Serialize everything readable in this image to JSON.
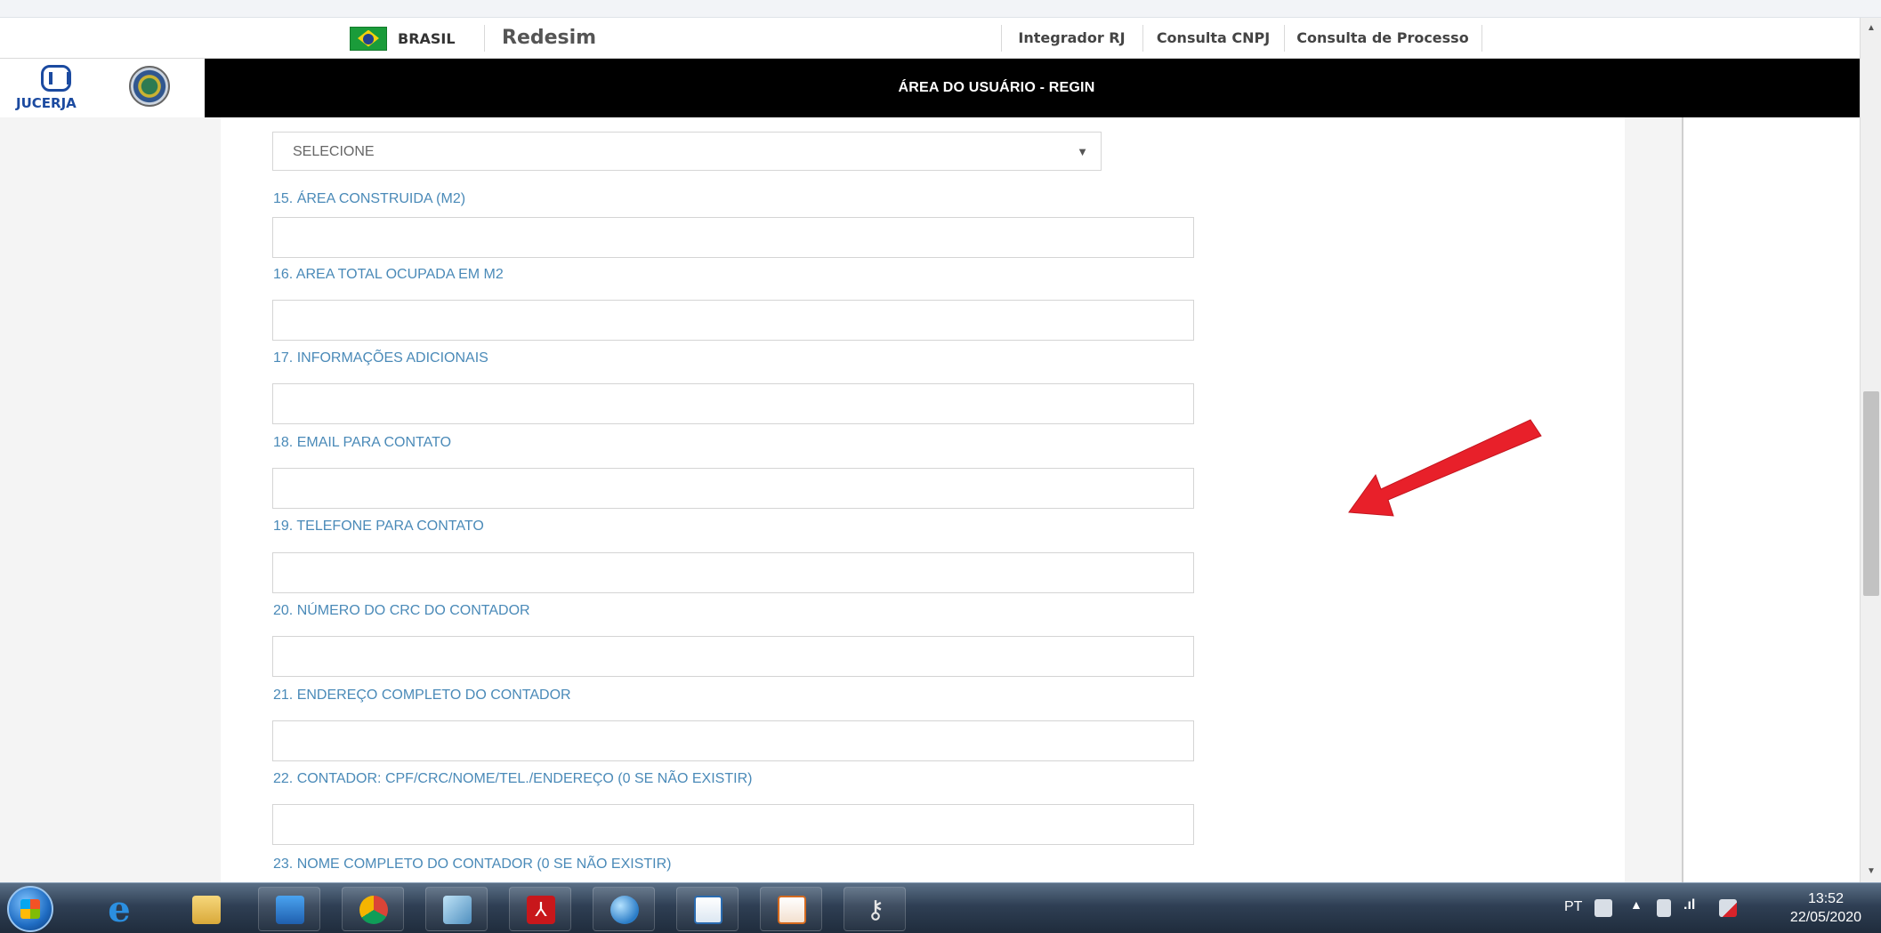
{
  "topbar": {
    "country_label": "BRASIL",
    "site_name": "Redesim",
    "links": [
      "Integrador RJ",
      "Consulta CNPJ",
      "Consulta de Processo"
    ]
  },
  "header": {
    "logo_text": "JUCERJA",
    "title": "ÁREA DO USUÁRIO - REGIN"
  },
  "form": {
    "select": {
      "value": "SELECIONE"
    },
    "fields": [
      {
        "label": "15. ÁREA CONSTRUIDA (M2)",
        "value": ""
      },
      {
        "label": "16. AREA TOTAL OCUPADA EM M2",
        "value": ""
      },
      {
        "label": "17. INFORMAÇÕES ADICIONAIS",
        "value": ""
      },
      {
        "label": "18. EMAIL PARA CONTATO",
        "value": ""
      },
      {
        "label": "19. TELEFONE PARA CONTATO",
        "value": ""
      },
      {
        "label": "20. NÚMERO DO CRC DO CONTADOR",
        "value": ""
      },
      {
        "label": "21. ENDEREÇO COMPLETO DO CONTADOR",
        "value": ""
      },
      {
        "label": "22. CONTADOR: CPF/CRC/NOME/TEL./ENDEREÇO (0 SE NÃO EXISTIR)",
        "value": ""
      }
    ],
    "last_label": "23. NOME COMPLETO DO CONTADOR (0 SE NÃO EXISTIR)"
  },
  "annotation": {
    "arrow_color": "#e8202a"
  },
  "taskbar": {
    "items": [
      "internet-explorer",
      "file-explorer",
      "media-player",
      "chrome",
      "notepad",
      "adobe-reader",
      "network-globe",
      "writer-document",
      "impress-presentation",
      "keys-utility"
    ],
    "tray": {
      "language": "PT",
      "time": "13:52",
      "date": "22/05/2020"
    }
  }
}
